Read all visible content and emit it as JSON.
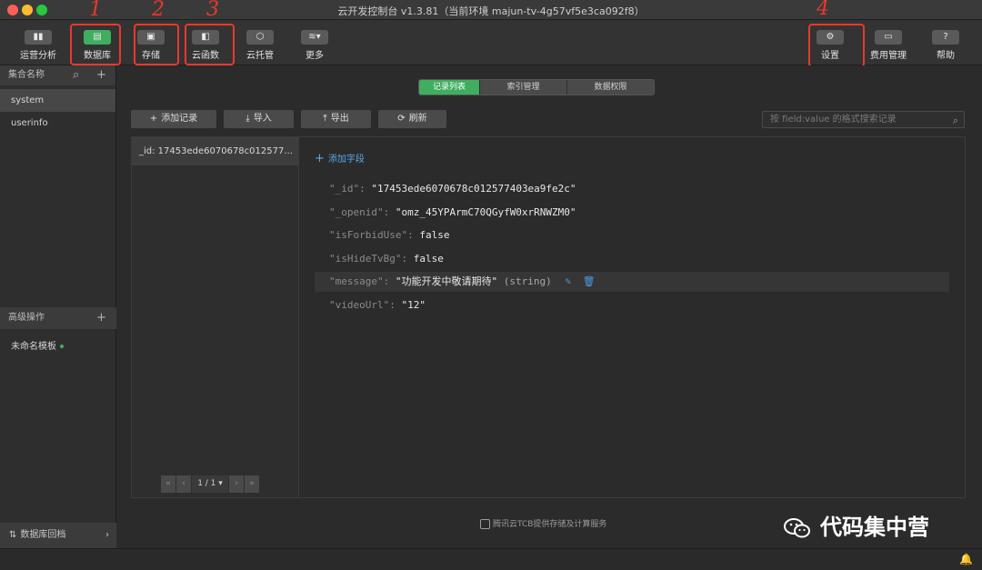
{
  "window": {
    "title": "云开发控制台 v1.3.81（当前环境 majun-tv-4g57vf5e3ca092f8）"
  },
  "toolbar": {
    "items": [
      {
        "label": "运营分析",
        "icon": "chart-icon",
        "glyph": "▮▮"
      },
      {
        "label": "数据库",
        "icon": "database-icon",
        "glyph": "▤",
        "active": true
      },
      {
        "label": "存储",
        "icon": "storage-icon",
        "glyph": "▣"
      },
      {
        "label": "云函数",
        "icon": "function-icon",
        "glyph": "◧"
      },
      {
        "label": "云托管",
        "icon": "cube-icon",
        "glyph": "⬡"
      },
      {
        "label": "更多",
        "icon": "more-icon",
        "glyph": "≋▾"
      },
      {
        "label": "设置",
        "icon": "gear-icon",
        "glyph": "⚙"
      },
      {
        "label": "费用管理",
        "icon": "billing-icon",
        "glyph": "▭"
      },
      {
        "label": "帮助",
        "icon": "help-icon",
        "glyph": "?"
      }
    ],
    "annotations": [
      "1",
      "2",
      "3",
      "4"
    ]
  },
  "sidebar": {
    "collections_header": "集合名称",
    "collections": [
      "system",
      "userinfo"
    ],
    "advanced_header": "高级操作",
    "template_item": "未命名模板",
    "footer": "数据库回档"
  },
  "main": {
    "tabs": [
      {
        "label": "记录列表",
        "active": true
      },
      {
        "label": "索引管理"
      },
      {
        "label": "数据权限"
      }
    ],
    "actions": {
      "add_record": "添加记录",
      "import": "导入",
      "export": "导出",
      "refresh": "刷新"
    },
    "search_placeholder": "按 field:value 的格式搜索记录",
    "records": [
      "_id: 17453ede6070678c012577..."
    ],
    "pagination": {
      "page": "1 / 1 ▾"
    },
    "add_field": "添加字段",
    "fields": [
      {
        "key": "\"_id\"",
        "value": "\"17453ede6070678c012577403ea9fe2c\""
      },
      {
        "key": "\"_openid\"",
        "value": "\"omz_45YPArmC70QGyfW0xrRNWZM0\""
      },
      {
        "key": "\"isForbidUse\"",
        "value": "false"
      },
      {
        "key": "\"isHideTvBg\"",
        "value": "false"
      },
      {
        "key": "\"message\"",
        "value": "\"功能开发中敬请期待\"",
        "type": "(string)"
      },
      {
        "key": "\"videoUrl\"",
        "value": "\"12\""
      }
    ],
    "footer_note": "腾讯云TCB提供存储及计算服务"
  },
  "watermark": {
    "text": "代码集中营"
  },
  "colors": {
    "accent": "#3fae5f",
    "annotation": "#e8392d",
    "link": "#5ba7e8"
  }
}
